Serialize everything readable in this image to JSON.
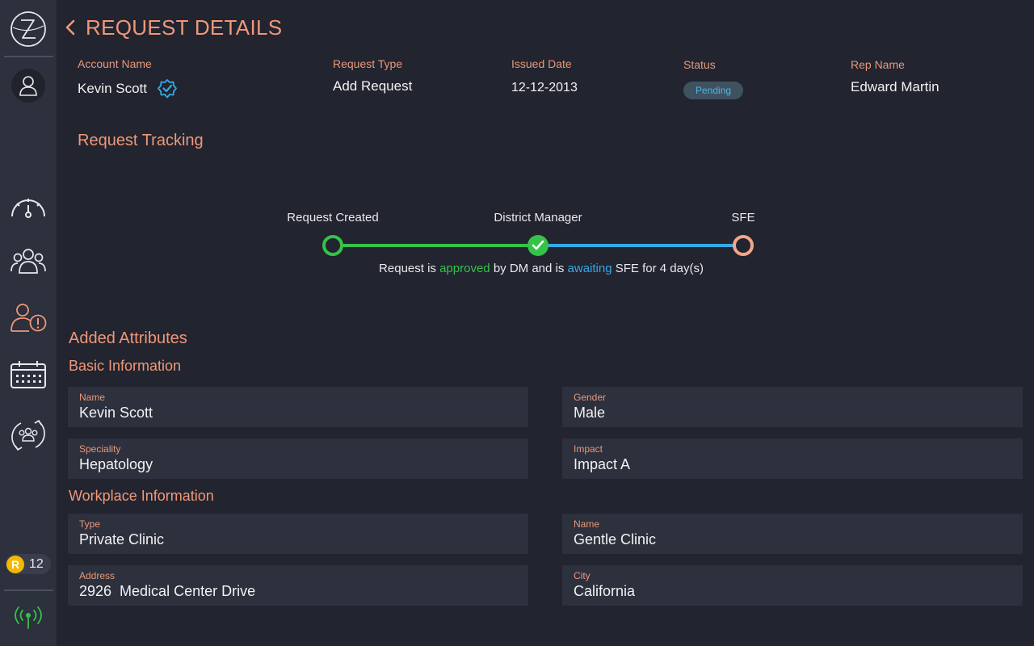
{
  "header": {
    "title": "REQUEST DETAILS"
  },
  "summary": {
    "account_name_label": "Account Name",
    "account_name": "Kevin Scott",
    "request_type_label": "Request Type",
    "request_type": "Add Request",
    "issued_date_label": "Issued Date",
    "issued_date": "12-12-2013",
    "status_label": "Status",
    "status": "Pending",
    "rep_name_label": "Rep Name",
    "rep_name": "Edward Martin"
  },
  "tracking": {
    "title": "Request Tracking",
    "steps": [
      {
        "label": "Request Created",
        "state": "done"
      },
      {
        "label": "District Manager",
        "state": "approved"
      },
      {
        "label": "SFE",
        "state": "pending"
      }
    ],
    "message_prefix": "Request is ",
    "message_approved": "approved",
    "message_middle": " by DM and is ",
    "message_awaiting": "awaiting",
    "message_suffix": " SFE for 4 day(s)"
  },
  "attributes": {
    "title": "Added Attributes",
    "basic": {
      "title": "Basic Information",
      "fields": [
        {
          "label": "Name",
          "value": "Kevin Scott"
        },
        {
          "label": "Gender",
          "value": "Male"
        },
        {
          "label": "Speciality",
          "value": "Hepatology"
        },
        {
          "label": "Impact",
          "value": "Impact A"
        }
      ]
    },
    "workplace": {
      "title": "Workplace Information",
      "fields": [
        {
          "label": "Type",
          "value": "Private Clinic"
        },
        {
          "label": "Name",
          "value": "Gentle Clinic"
        },
        {
          "label": "Address",
          "value": "2926  Medical Center Drive"
        },
        {
          "label": "City",
          "value": "California"
        }
      ]
    }
  },
  "sidebar": {
    "icons": [
      "logo-icon",
      "user-icon",
      "dashboard-gauge-icon",
      "team-icon",
      "user-alert-icon",
      "calendar-icon",
      "team-sync-icon",
      "signal-icon"
    ],
    "r_badge_letter": "R",
    "r_count": "12"
  },
  "colors": {
    "accent": "#ef9878",
    "approved": "#35c24a",
    "awaiting": "#36a9e6",
    "pending_node": "#f2a68a",
    "background": "#22242f",
    "panel": "#2d303d"
  }
}
